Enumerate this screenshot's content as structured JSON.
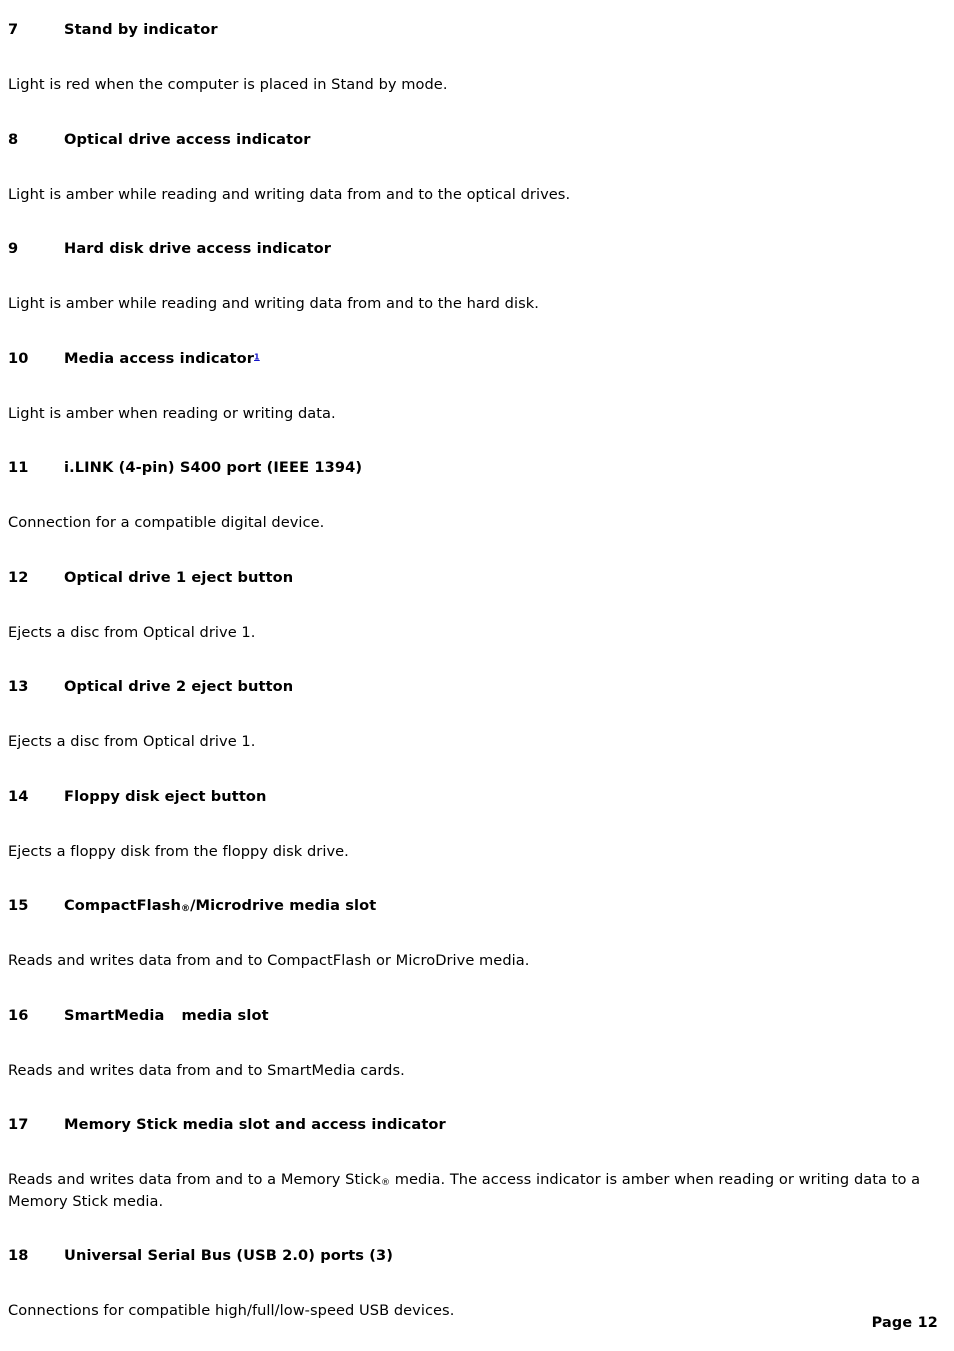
{
  "page": {
    "background_color": "#ffffff",
    "text_color": "#000000",
    "footnote_link_color": "#1414c8",
    "footer_label": "Page 12"
  },
  "entries": [
    {
      "number": "7",
      "title": "Stand by indicator",
      "body": "Light is red when the computer is placed in Stand by mode."
    },
    {
      "number": "8",
      "title": "Optical drive access indicator",
      "body": "Light is amber while reading and writing data from and to the optical drives."
    },
    {
      "number": "9",
      "title": "Hard disk drive access indicator",
      "body": "Light is amber while reading and writing data from and to the hard disk."
    },
    {
      "number": "10",
      "title": "Media access indicator",
      "title_footnote_ref": "1",
      "body": "Light is amber when reading or writing data."
    },
    {
      "number": "11",
      "title": "i.LINK (4-pin) S400 port (IEEE 1394)",
      "body": "Connection for a compatible digital device."
    },
    {
      "number": "12",
      "title": "Optical drive 1 eject button",
      "body": "Ejects a disc from Optical drive 1."
    },
    {
      "number": "13",
      "title": "Optical drive 2 eject button",
      "body": "Ejects a disc from Optical drive 1."
    },
    {
      "number": "14",
      "title": "Floppy disk eject button",
      "body": "Ejects a floppy disk from the floppy disk drive."
    },
    {
      "number": "15",
      "title_part1": "CompactFlash",
      "title_mark": "®",
      "title_part2": "/Microdrive media slot",
      "body": "Reads and writes data from and to CompactFlash or MicroDrive media."
    },
    {
      "number": "16",
      "title_part1": "SmartMedia",
      "title_part2": "media slot",
      "body": "Reads and writes data from and to SmartMedia cards."
    },
    {
      "number": "17",
      "title": "Memory Stick media slot and access indicator",
      "body_part1": "Reads and writes data from and to a Memory Stick",
      "body_mark": "®",
      "body_part2": " media. The access indicator is amber when reading or writing data to a Memory Stick media."
    },
    {
      "number": "18",
      "title": "Universal Serial Bus (USB 2.0) ports (3)",
      "body": "Connections for compatible high/full/low-speed USB devices."
    }
  ]
}
